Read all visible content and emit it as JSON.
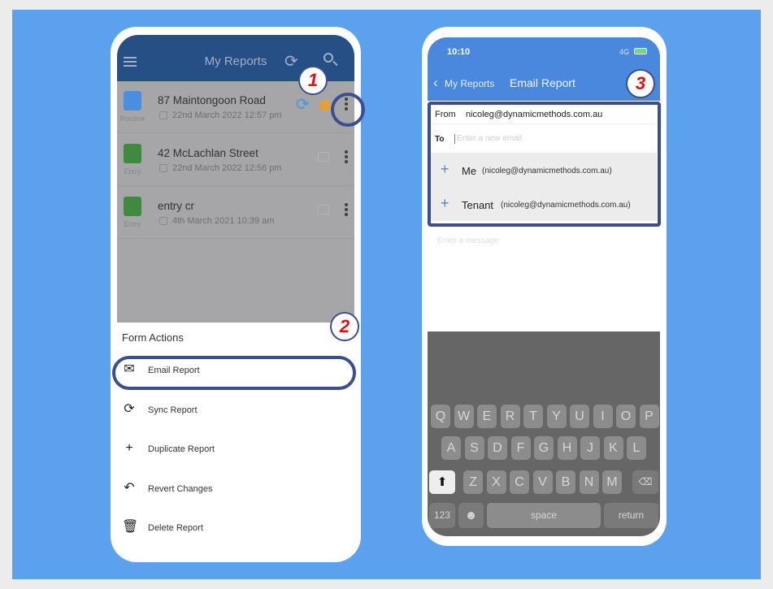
{
  "left_phone": {
    "header": {
      "title": "My Reports",
      "menu_icon": "hamburger-icon",
      "sync_icon": "sync-icon",
      "search_icon": "search-icon",
      "color": "#264f86"
    },
    "reports": [
      {
        "title": "87 Maintongoon Road",
        "date": "22nd March 2022 12:57 pm",
        "type": "Routine",
        "type_color": "#4a8ee0",
        "sync": true,
        "locked": true
      },
      {
        "title": "42 McLachlan Street",
        "date": "22nd March 2022 12:56 pm",
        "type": "Entry",
        "type_color": "#3e8a3e",
        "sync": false,
        "locked": false
      },
      {
        "title": "entry cr",
        "date": "4th March 2021 10:39 am",
        "type": "Entry",
        "type_color": "#3e8a3e",
        "sync": false,
        "locked": false
      }
    ],
    "sheet": {
      "title": "Form Actions",
      "actions": [
        {
          "label": "Email Report",
          "icon": "envelope-icon"
        },
        {
          "label": "Sync Report",
          "icon": "sync-icon"
        },
        {
          "label": "Duplicate Report",
          "icon": "plus-icon"
        },
        {
          "label": "Revert Changes",
          "icon": "undo-icon"
        },
        {
          "label": "Delete Report",
          "icon": "trash-icon"
        }
      ]
    }
  },
  "right_phone": {
    "status": {
      "time": "10:10",
      "network": "4G"
    },
    "header": {
      "back": "My Reports",
      "title": "Email Report",
      "color": "#4a88dd"
    },
    "from_label": "From",
    "from_value": "nicoleg@dynamicmethods.com.au",
    "to_label": "To",
    "to_placeholder": "Enter a new email",
    "suggestions": [
      {
        "name": "Me",
        "email": "(nicoleg@dynamicmethods.com.au)"
      },
      {
        "name": "Tenant",
        "email": "(nicoleg@dynamicmethods.com.au)"
      }
    ],
    "message_placeholder": "Enter a message",
    "keyboard": {
      "row1": [
        "Q",
        "W",
        "E",
        "R",
        "T",
        "Y",
        "U",
        "I",
        "O",
        "P"
      ],
      "row2": [
        "A",
        "S",
        "D",
        "F",
        "G",
        "H",
        "J",
        "K",
        "L"
      ],
      "row3": [
        "Z",
        "X",
        "C",
        "V",
        "B",
        "N",
        "M"
      ],
      "numbers": "123",
      "space": "space",
      "return": "return"
    }
  },
  "badges": [
    "1",
    "2",
    "3"
  ],
  "colors": {
    "background": "#5ba1ee",
    "highlight": "#3b4f8e",
    "badge_number": "#e01010"
  }
}
